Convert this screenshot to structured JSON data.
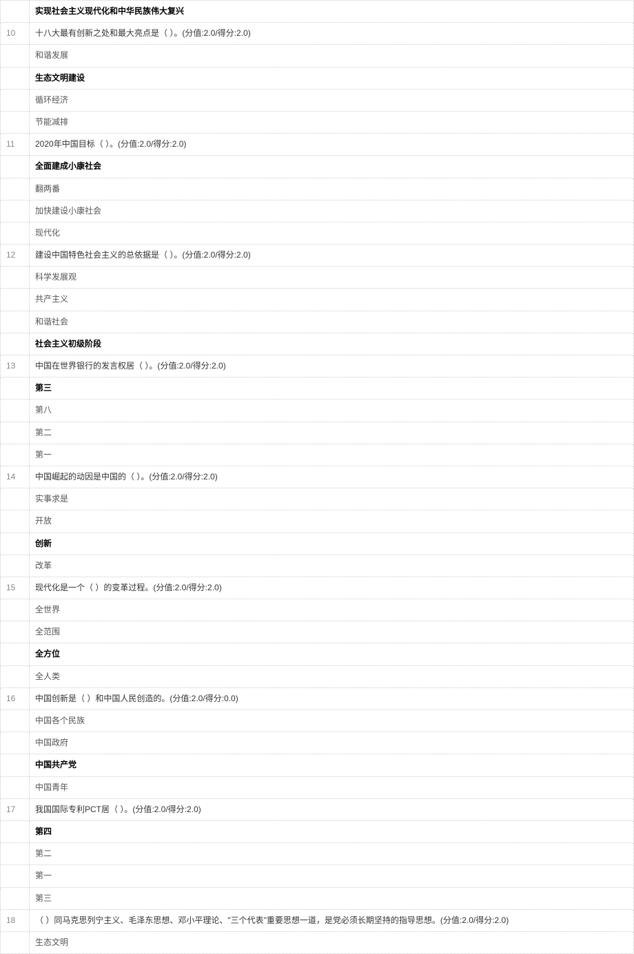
{
  "prev_q9_last_option": "实现社会主义现代化和中华民族伟大复兴",
  "questions": [
    {
      "num": "10",
      "text": "十八大最有创新之处和最大亮点是（ ）。(分值:2.0/得分:2.0)",
      "options": [
        "和谐发展",
        "生态文明建设",
        "循环经济",
        "节能减排"
      ],
      "correct_index": 1
    },
    {
      "num": "11",
      "text": "2020年中国目标（ ）。(分值:2.0/得分:2.0)",
      "options": [
        "全面建成小康社会",
        "翻两番",
        "加快建设小康社会",
        "现代化"
      ],
      "correct_index": 0
    },
    {
      "num": "12",
      "text": "建设中国特色社会主义的总依据是（ ）。(分值:2.0/得分:2.0)",
      "options": [
        "科学发展观",
        "共产主义",
        "和谐社会",
        "社会主义初级阶段"
      ],
      "correct_index": 3
    },
    {
      "num": "13",
      "text": "中国在世界银行的发言权居（ ）。(分值:2.0/得分:2.0)",
      "options": [
        "第三",
        "第八",
        "第二",
        "第一"
      ],
      "correct_index": 0
    },
    {
      "num": "14",
      "text": "中国崛起的动因是中国的（ ）。(分值:2.0/得分:2.0)",
      "options": [
        "实事求是",
        "开放",
        "创新",
        "改革"
      ],
      "correct_index": 2
    },
    {
      "num": "15",
      "text": "现代化是一个（ ）的变革过程。(分值:2.0/得分:2.0)",
      "options": [
        "全世界",
        "全范围",
        "全方位",
        "全人类"
      ],
      "correct_index": 2
    },
    {
      "num": "16",
      "text": "中国创新是（ ）和中国人民创造的。(分值:2.0/得分:0.0)",
      "options": [
        "中国各个民族",
        "中国政府",
        "中国共产党",
        "中国青年"
      ],
      "correct_index": 2
    },
    {
      "num": "17",
      "text": "我国国际专利PCT居（ ）。(分值:2.0/得分:2.0)",
      "options": [
        "第四",
        "第二",
        "第一",
        "第三"
      ],
      "correct_index": 0
    },
    {
      "num": "18",
      "text": "（ ）同马克思列宁主义、毛泽东思想、邓小平理论、\"三个代表\"重要思想一道，是党必须长期坚持的指导思想。(分值:2.0/得分:2.0)",
      "options": [
        "生态文明"
      ],
      "correct_index": -1
    }
  ]
}
